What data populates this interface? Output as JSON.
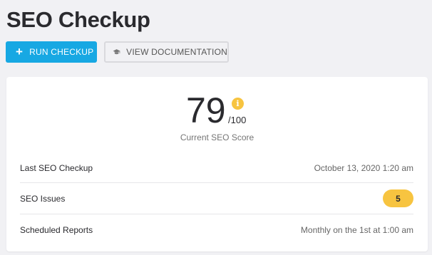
{
  "page": {
    "title": "SEO Checkup"
  },
  "toolbar": {
    "run_label": "RUN CHECKUP",
    "docs_label": "VIEW DOCUMENTATION"
  },
  "score": {
    "value": "79",
    "max": "/100",
    "info_glyph": "i",
    "caption": "Current SEO Score"
  },
  "rows": [
    {
      "label": "Last SEO Checkup",
      "value": "October 13, 2020 1:20 am"
    },
    {
      "label": "SEO Issues",
      "value": "5"
    },
    {
      "label": "Scheduled Reports",
      "value": "Monthly on the 1st at 1:00 am"
    }
  ],
  "colors": {
    "accent": "#17a8e3",
    "warning": "#f7c440"
  },
  "icons": {
    "run": "plus-icon",
    "docs": "graduation-cap-icon",
    "score_info": "info-icon"
  }
}
